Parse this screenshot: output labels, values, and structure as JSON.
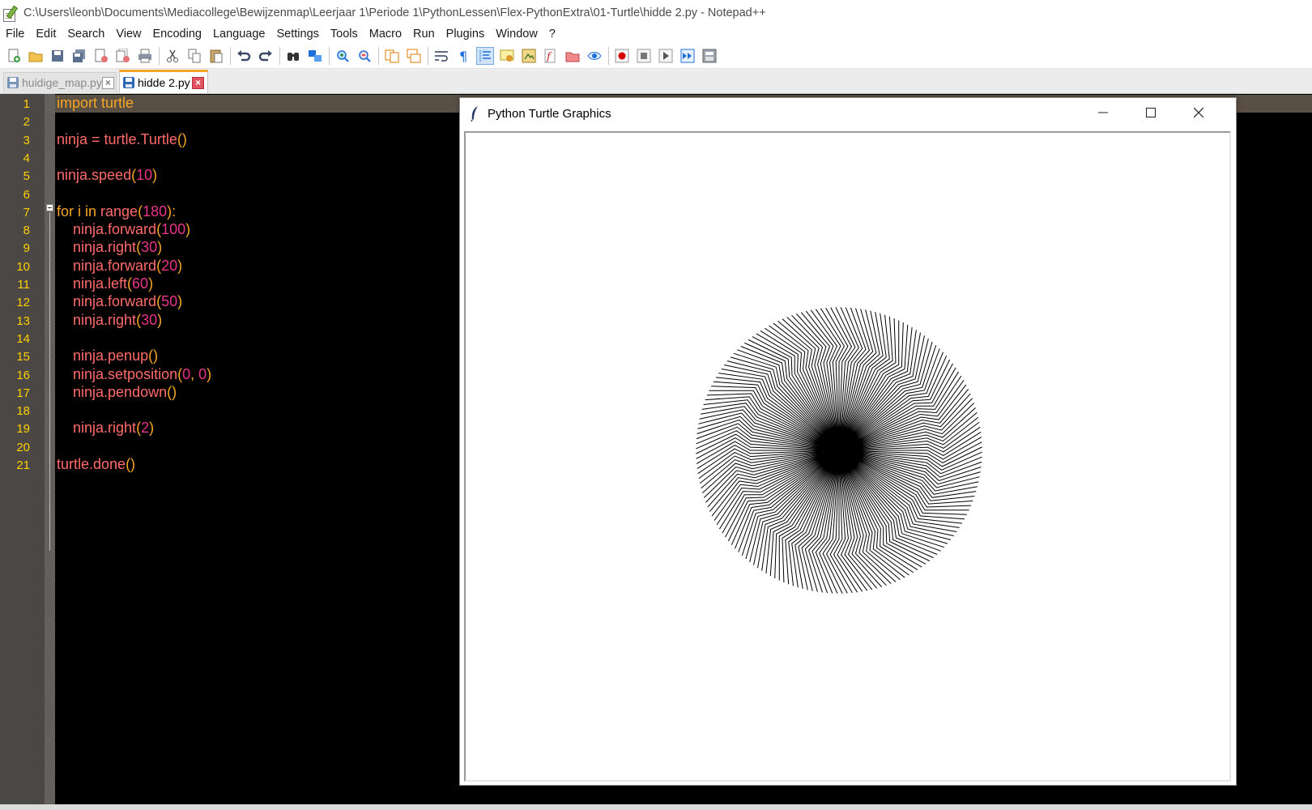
{
  "window": {
    "title": "C:\\Users\\leonb\\Documents\\Mediacollege\\Bewijzenmap\\Leerjaar 1\\Periode 1\\PythonLessen\\Flex-PythonExtra\\01-Turtle\\hidde 2.py - Notepad++"
  },
  "menu": [
    "File",
    "Edit",
    "Search",
    "View",
    "Encoding",
    "Language",
    "Settings",
    "Tools",
    "Macro",
    "Run",
    "Plugins",
    "Window",
    "?"
  ],
  "tabs": [
    {
      "label": "huidige_map.py",
      "active": false
    },
    {
      "label": "hidde 2.py",
      "active": true
    }
  ],
  "colors": {
    "editor_bg": "#000000",
    "keyword": "#f5a623",
    "identifier": "#ff6b6b",
    "number": "#e8338a",
    "line_number": "#ffd000",
    "active_tab_accent": "#f5a623"
  },
  "code": {
    "line_numbers": [
      "1",
      "2",
      "3",
      "4",
      "5",
      "6",
      "7",
      "8",
      "9",
      "10",
      "11",
      "12",
      "13",
      "14",
      "15",
      "16",
      "17",
      "18",
      "19",
      "20",
      "21"
    ],
    "lines": [
      [
        {
          "t": "import turtle",
          "c": "kw"
        }
      ],
      [],
      [
        {
          "t": "ninja = turtle.Turtle",
          "c": "id"
        },
        {
          "t": "()",
          "c": "pn"
        }
      ],
      [],
      [
        {
          "t": "ninja.speed",
          "c": "id"
        },
        {
          "t": "(",
          "c": "pn"
        },
        {
          "t": "10",
          "c": "nm"
        },
        {
          "t": ")",
          "c": "pn"
        }
      ],
      [],
      [
        {
          "t": "for i in ",
          "c": "kw"
        },
        {
          "t": "range",
          "c": "id"
        },
        {
          "t": "(",
          "c": "pn"
        },
        {
          "t": "180",
          "c": "nm"
        },
        {
          "t": "):",
          "c": "pn"
        }
      ],
      [
        {
          "t": "    ninja.forward",
          "c": "id"
        },
        {
          "t": "(",
          "c": "pn"
        },
        {
          "t": "100",
          "c": "nm"
        },
        {
          "t": ")",
          "c": "pn"
        }
      ],
      [
        {
          "t": "    ninja.right",
          "c": "id"
        },
        {
          "t": "(",
          "c": "pn"
        },
        {
          "t": "30",
          "c": "nm"
        },
        {
          "t": ")",
          "c": "pn"
        }
      ],
      [
        {
          "t": "    ninja.forward",
          "c": "id"
        },
        {
          "t": "(",
          "c": "pn"
        },
        {
          "t": "20",
          "c": "nm"
        },
        {
          "t": ")",
          "c": "pn"
        }
      ],
      [
        {
          "t": "    ninja.left",
          "c": "id"
        },
        {
          "t": "(",
          "c": "pn"
        },
        {
          "t": "60",
          "c": "nm"
        },
        {
          "t": ")",
          "c": "pn"
        }
      ],
      [
        {
          "t": "    ninja.forward",
          "c": "id"
        },
        {
          "t": "(",
          "c": "pn"
        },
        {
          "t": "50",
          "c": "nm"
        },
        {
          "t": ")",
          "c": "pn"
        }
      ],
      [
        {
          "t": "    ninja.right",
          "c": "id"
        },
        {
          "t": "(",
          "c": "pn"
        },
        {
          "t": "30",
          "c": "nm"
        },
        {
          "t": ")",
          "c": "pn"
        }
      ],
      [],
      [
        {
          "t": "    ninja.penup",
          "c": "id"
        },
        {
          "t": "()",
          "c": "pn"
        }
      ],
      [
        {
          "t": "    ninja.setposition",
          "c": "id"
        },
        {
          "t": "(",
          "c": "pn"
        },
        {
          "t": "0",
          "c": "nm"
        },
        {
          "t": ", ",
          "c": "pn"
        },
        {
          "t": "0",
          "c": "nm"
        },
        {
          "t": ")",
          "c": "pn"
        }
      ],
      [
        {
          "t": "    ninja.pendown",
          "c": "id"
        },
        {
          "t": "()",
          "c": "pn"
        }
      ],
      [],
      [
        {
          "t": "    ninja.right",
          "c": "id"
        },
        {
          "t": "(",
          "c": "pn"
        },
        {
          "t": "2",
          "c": "nm"
        },
        {
          "t": ")",
          "c": "pn"
        }
      ],
      [],
      [
        {
          "t": "turtle.done",
          "c": "id"
        },
        {
          "t": "()",
          "c": "pn"
        }
      ]
    ]
  },
  "turtle_window": {
    "title": "Python Turtle Graphics",
    "controls": [
      "minimize-icon",
      "maximize-icon",
      "close-icon"
    ],
    "drawing": {
      "iterations": 180,
      "turn_per_iteration": 2,
      "segments": [
        {
          "action": "forward",
          "value": 100
        },
        {
          "action": "right",
          "value": 30
        },
        {
          "action": "forward",
          "value": 20
        },
        {
          "action": "left",
          "value": 60
        },
        {
          "action": "forward",
          "value": 50
        },
        {
          "action": "right",
          "value": 30
        }
      ],
      "stroke": "#000000"
    }
  }
}
